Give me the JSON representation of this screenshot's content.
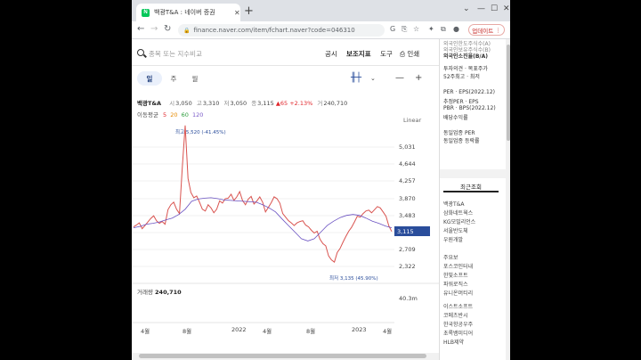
{
  "browser": {
    "tab_title": "백광T&A : 네이버 증권",
    "favicon_letter": "N",
    "url": "finance.naver.com/item/fchart.naver?code=046310",
    "update_label": "업데이트"
  },
  "search": {
    "placeholder": "종목 또는 지수비교",
    "links": [
      "공시",
      "보조지표",
      "도구",
      "인쇄"
    ]
  },
  "periods": [
    "일",
    "주",
    "월"
  ],
  "quote": {
    "name": "백광T&A",
    "open_label": "시",
    "open": "3,050",
    "high_label": "고",
    "high": "3,310",
    "low_label": "저",
    "low": "3,050",
    "close_label": "종",
    "close": "3,115",
    "change": "▲65 +2.13%",
    "volume_label": "거",
    "volume": "240,710"
  },
  "moving_average": {
    "label": "이동평균",
    "ma5": "5",
    "ma20": "20",
    "ma60": "60",
    "ma120": "120"
  },
  "scale_label": "Linear",
  "chart_data": {
    "type": "line",
    "title": "",
    "y_ticks": [
      "5,031",
      "4,644",
      "4,257",
      "3,870",
      "3,483",
      "3,096",
      "2,709",
      "2,322"
    ],
    "x_ticks": [
      "4월",
      "8월",
      "2022",
      "4월",
      "8월",
      "2023",
      "4월"
    ],
    "current_price": "3,115",
    "max_annotation": "최고 5,520 (-41.45%)",
    "min_annotation": "최저 3,135 (45.90%)",
    "volume_label": "거래량",
    "volume_value": "240,710",
    "volume_max": "40.3m",
    "series": [
      {
        "values": [
          3220,
          3260,
          3310,
          3180,
          3250,
          3330,
          3410,
          3470,
          3360,
          3300,
          3340,
          3280,
          3610,
          3720,
          3780,
          3620,
          3520,
          4580,
          5520,
          4320,
          4000,
          3880,
          3920,
          3780,
          3620,
          3580,
          3720,
          3650,
          3540,
          3620,
          3810,
          3760,
          3860,
          3870,
          3960,
          3820,
          3900,
          4020,
          3820,
          3720,
          3850,
          3910,
          3740,
          3810,
          3900,
          3780,
          3560,
          3660,
          3770,
          3900,
          3860,
          3760,
          3520,
          3440,
          3360,
          3310,
          3250,
          3310,
          3340,
          3360,
          3260,
          3220,
          3140,
          3080,
          3120,
          2940,
          2840,
          2790,
          2560,
          2470,
          2420,
          2640,
          2730,
          2870,
          3000,
          3120,
          3210,
          3330,
          3460,
          3440,
          3520,
          3580,
          3600,
          3540,
          3610,
          3680,
          3650,
          3560,
          3460,
          3240,
          3115
        ]
      },
      {
        "values": [
          3200,
          3230,
          3280,
          3300,
          3330,
          3380,
          3420,
          3500,
          3620,
          3800,
          3850,
          3870,
          3880,
          3860,
          3830,
          3820,
          3810,
          3800,
          3790,
          3780,
          3720,
          3650,
          3560,
          3400,
          3250,
          3100,
          2950,
          2900,
          2950,
          3100,
          3250,
          3350,
          3430,
          3480,
          3500,
          3480,
          3420,
          3350,
          3300,
          3240,
          3200
        ]
      }
    ]
  },
  "right_panel": {
    "top_items": [
      "외국인한도주식수(A)",
      "외국인보유주식수(B)",
      "외국인소진율(B/A)",
      "투자의견 · 목표주가",
      "52주최고 · 최저",
      "PER · EPS(2022.12)",
      "추정PER · EPS",
      "PBR · BPS(2022.12)",
      "배당수익률",
      "동일업종 PER",
      "동일업종 등락률"
    ],
    "recent_tab": "최근조회",
    "recent_items": [
      "백광T&A",
      "삼화네트웍스",
      "KG모빌리언스",
      "서울반도체",
      "우원개발",
      "주요보",
      "포스코인터내",
      "한빛소프트",
      "파워로직스",
      "유니온머티리",
      "이스트소프트",
      "코메츠반시",
      "한국항공우주",
      "초록뱀미디어",
      "HLB제약"
    ]
  }
}
